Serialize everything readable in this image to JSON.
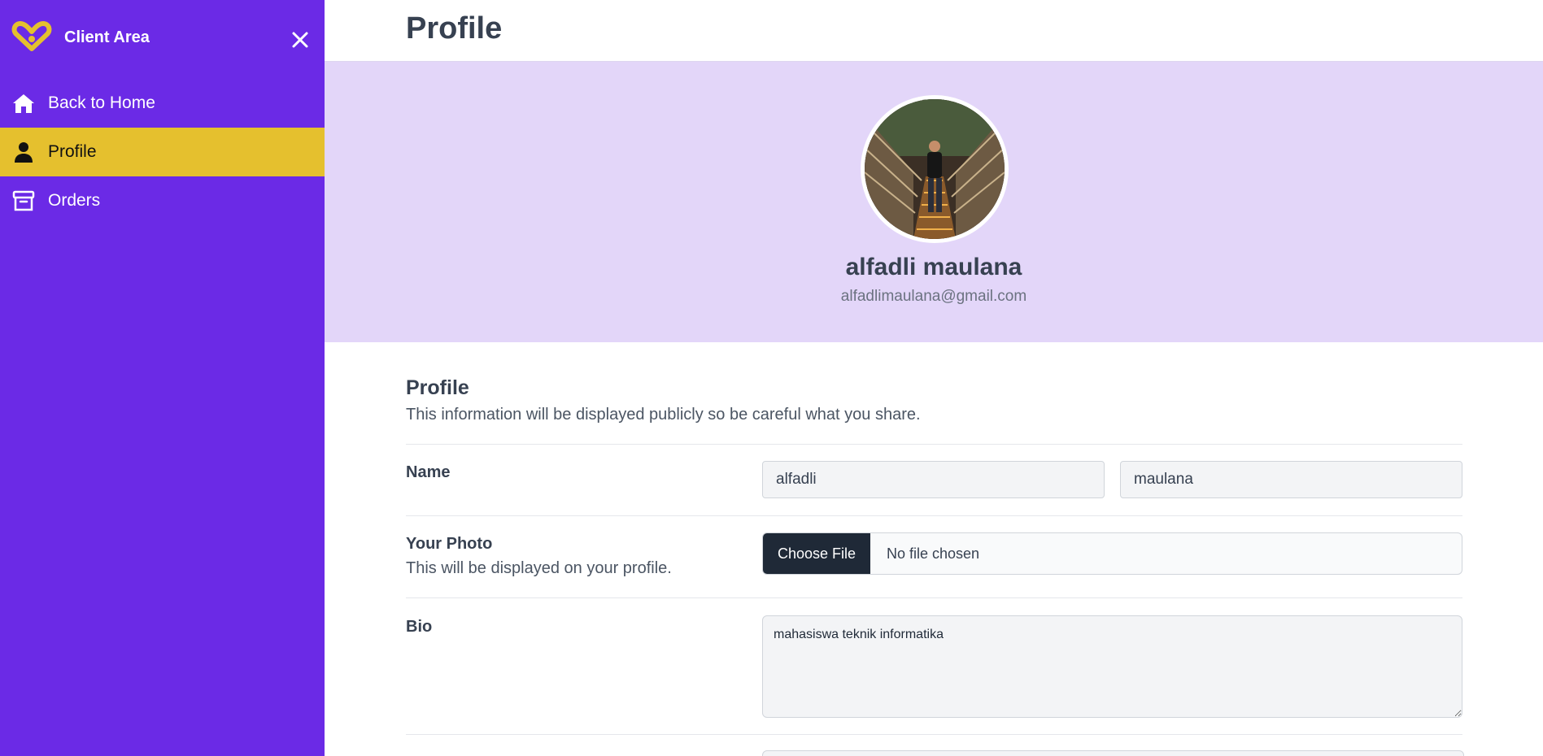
{
  "sidebar": {
    "brand_title": "Client Area",
    "items": [
      {
        "label": "Back to Home",
        "icon": "home-icon",
        "active": false
      },
      {
        "label": "Profile",
        "icon": "user-icon",
        "active": true
      },
      {
        "label": "Orders",
        "icon": "archive-icon",
        "active": false
      }
    ]
  },
  "header": {
    "title": "Profile"
  },
  "banner": {
    "name": "alfadli maulana",
    "email": "alfadlimaulana@gmail.com"
  },
  "form": {
    "section_title": "Profile",
    "section_description": "This information will be displayed publicly so be careful what you share.",
    "name_label": "Name",
    "first_name": "alfadli",
    "last_name": "maulana",
    "photo_label": "Your Photo",
    "photo_hint": "This will be displayed on your profile.",
    "choose_file_label": "Choose File",
    "file_status": "No file chosen",
    "bio_label": "Bio",
    "bio_value": "mahasiswa teknik informatika"
  },
  "colors": {
    "sidebar": "#6b2ae6",
    "active_item": "#e5c02e",
    "banner": "#e3d6f9",
    "logo": "#e5c02e"
  }
}
